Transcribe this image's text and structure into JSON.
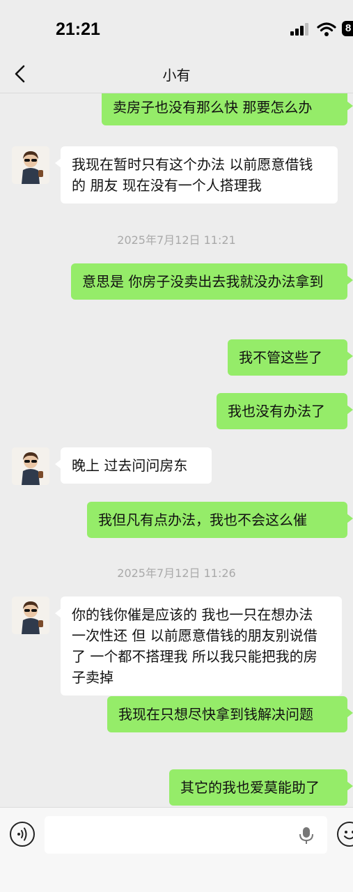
{
  "status_bar": {
    "time": "21:21",
    "battery": "8"
  },
  "nav": {
    "title": "小有"
  },
  "messages": [
    {
      "side": "me",
      "text": "卖房子也没有那么快 那要怎么办"
    },
    {
      "side": "them",
      "text": "我现在暂时只有这个办法 以前愿意借钱的 朋友 现在没有一个人搭理我"
    },
    {
      "timestamp": "2025年7月12日 11:21"
    },
    {
      "side": "me",
      "text": "意思是 你房子没卖出去我就没办法拿到"
    },
    {
      "side": "me",
      "text": "我不管这些了"
    },
    {
      "side": "me",
      "text": "我也没有办法了"
    },
    {
      "side": "them",
      "text": "晚上 过去问问房东"
    },
    {
      "side": "me",
      "text": "我但凡有点办法，我也不会这么催"
    },
    {
      "timestamp": "2025年7月12日 11:26"
    },
    {
      "side": "them",
      "text": "你的钱你催是应该的 我也一只在想办法 一次性还 但 以前愿意借钱的朋友别说借了 一个都不搭理我 所以我只能把我的房子卖掉"
    },
    {
      "side": "me",
      "text": "我现在只想尽快拿到钱解决问题"
    },
    {
      "side": "me",
      "text": "其它的我也爱莫能助了"
    }
  ],
  "input": {
    "value": ""
  }
}
